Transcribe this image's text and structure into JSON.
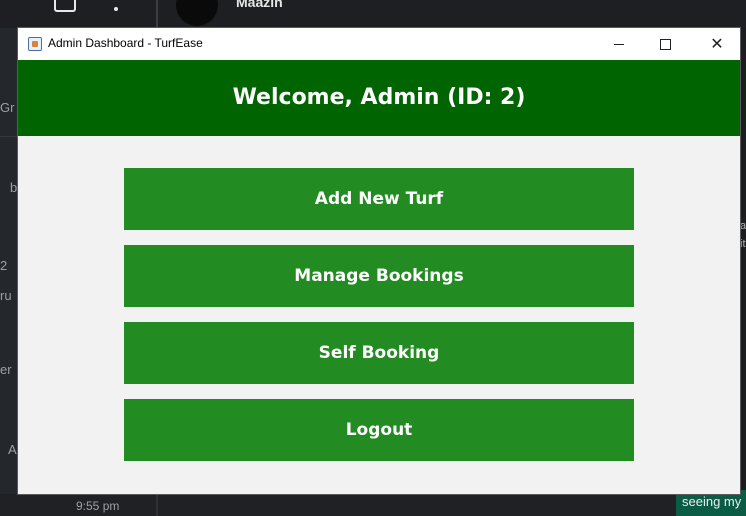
{
  "background_app": {
    "contact_name": "Maazin",
    "time": "9:55 pm",
    "message_preview": "seeing my",
    "left_fragments": [
      "Gr",
      "b",
      "2",
      "ru",
      "er",
      "A"
    ],
    "right_fragments": [
      "a",
      "it"
    ]
  },
  "window": {
    "title": "Admin Dashboard - TurfEase",
    "controls": {
      "minimize": "–",
      "maximize": "",
      "close": "✕"
    }
  },
  "header": {
    "welcome_text": "Welcome, Admin (ID: 2)"
  },
  "actions": [
    {
      "label": "Add New Turf"
    },
    {
      "label": "Manage Bookings"
    },
    {
      "label": "Self Booking"
    },
    {
      "label": "Logout"
    }
  ],
  "colors": {
    "header_bg": "#006400",
    "button_bg": "#228b22",
    "content_bg": "#f2f2f2",
    "button_text": "#ffffff"
  }
}
